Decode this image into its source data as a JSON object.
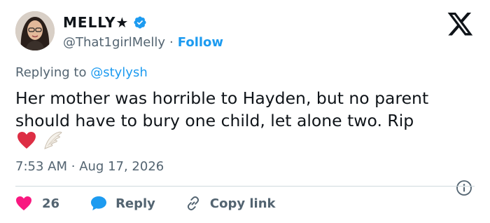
{
  "author": {
    "display_name": "MELLY★",
    "handle": "@That1girlMelly",
    "separator": "·",
    "follow_label": "Follow",
    "verified_color": "#1d9bf0"
  },
  "reply_context": {
    "prefix": "Replying to",
    "mention": "@stylysh"
  },
  "tweet": {
    "text": "Her mother was horrible to Hayden, but no parent should have to bury one child, let alone two. Rip",
    "emojis": [
      "red-heart",
      "angel-wing"
    ],
    "time": "7:53 AM",
    "separator": "·",
    "date": "Aug 17, 2026"
  },
  "actions": {
    "like_count": "26",
    "reply_label": "Reply",
    "copy_label": "Copy link"
  },
  "colors": {
    "accent": "#1d9bf0",
    "like": "#f91880",
    "text": "#0f1419",
    "muted": "#536471"
  }
}
